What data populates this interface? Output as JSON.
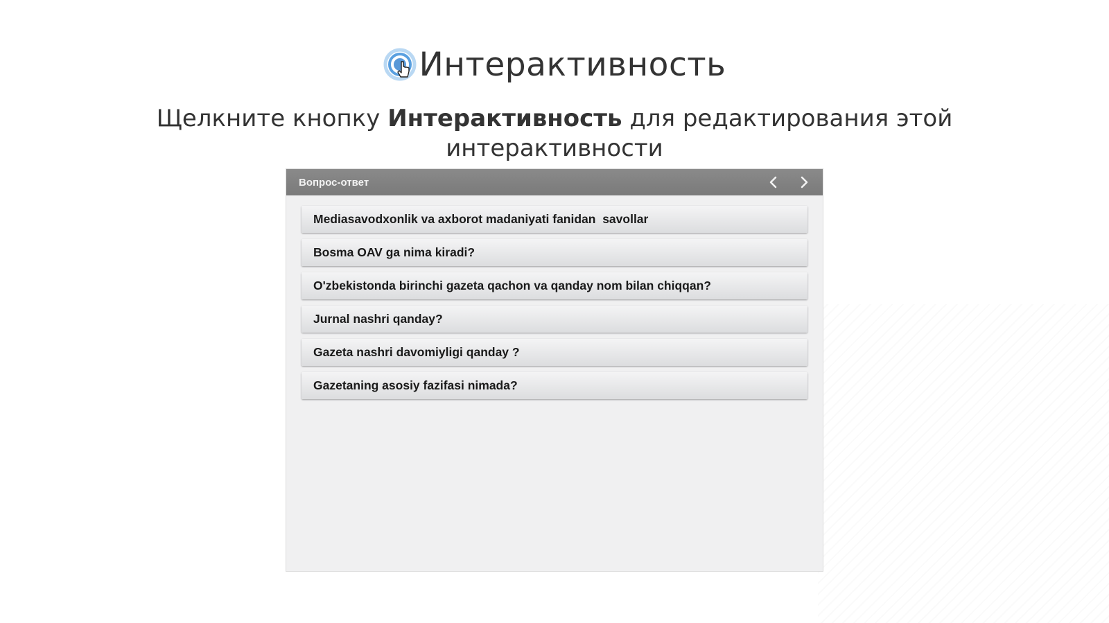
{
  "slide": {
    "title": "Интерактивность",
    "title_icon": "touch-hand-icon",
    "instruction": {
      "prefix": "Щелкните кнопку ",
      "bold": "Интерактивность",
      "suffix": " для редактирования этой интерактивности"
    }
  },
  "widget": {
    "title": "Вопрос-ответ",
    "nav": {
      "prev_icon": "chevron-left-icon",
      "next_icon": "chevron-right-icon"
    },
    "questions": [
      "Mediasavodxonlik va axborot madaniyati fanidan  savollar",
      "Bosma OAV ga nima kiradi?",
      "O'zbekistonda birinchi gazeta qachon va qanday nom bilan chiqqan?",
      "Jurnal nashri qanday?",
      "Gazeta nashri davomiyligi qanday ?",
      "Gazetaning asosiy fazifasi nimada?"
    ]
  },
  "colors": {
    "header_bg": "#818181",
    "panel_bg": "#f0f0f1",
    "item_bg": "#e6e7e8",
    "icon_blue": "#4a90d9"
  }
}
